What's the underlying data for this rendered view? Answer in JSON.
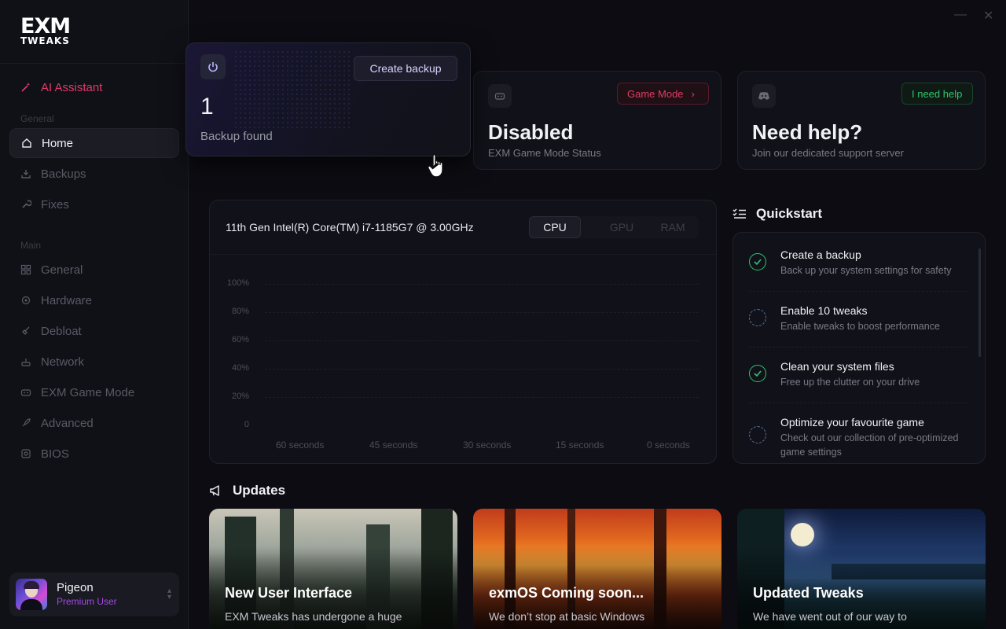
{
  "app": {
    "logo_line1": "EXM",
    "logo_line2": "TWEAKS"
  },
  "sidebar": {
    "ai_label": "AI Assistant",
    "section_general": "General",
    "section_main": "Main",
    "items_general": [
      {
        "label": "Home",
        "icon": "home-icon"
      },
      {
        "label": "Backups",
        "icon": "backup-icon"
      },
      {
        "label": "Fixes",
        "icon": "wrench-icon"
      }
    ],
    "items_main": [
      {
        "label": "General",
        "icon": "grid-icon"
      },
      {
        "label": "Hardware",
        "icon": "chip-icon"
      },
      {
        "label": "Debloat",
        "icon": "broom-icon"
      },
      {
        "label": "Network",
        "icon": "network-icon"
      },
      {
        "label": "EXM Game Mode",
        "icon": "gamepad-icon"
      },
      {
        "label": "Advanced",
        "icon": "rocket-icon"
      },
      {
        "label": "BIOS",
        "icon": "bios-icon"
      }
    ]
  },
  "user": {
    "name": "Pigeon",
    "role": "Premium User"
  },
  "cards": {
    "backup": {
      "button": "Create backup",
      "count": "1",
      "label": "Backup found"
    },
    "gamemode": {
      "button": "Game Mode",
      "status": "Disabled",
      "label": "EXM Game Mode Status"
    },
    "help": {
      "button": "I need help",
      "title": "Need help?",
      "label": "Join our dedicated support server"
    }
  },
  "monitor": {
    "cpu_name": "11th Gen Intel(R) Core(TM) i7-1185G7 @ 3.00GHz",
    "tabs": [
      "CPU",
      "GPU",
      "RAM"
    ],
    "active_tab": "CPU"
  },
  "chart_data": {
    "type": "line",
    "title": "",
    "yticks": [
      "100%",
      "80%",
      "60%",
      "40%",
      "20%",
      "0"
    ],
    "xticks": [
      "60 seconds",
      "45 seconds",
      "30 seconds",
      "15 seconds",
      "0 seconds"
    ],
    "ylim": [
      0,
      100
    ],
    "grid": true,
    "series": []
  },
  "quickstart": {
    "title": "Quickstart",
    "items": [
      {
        "title": "Create a backup",
        "desc": "Back up your system settings for safety",
        "done": true
      },
      {
        "title": "Enable 10 tweaks",
        "desc": "Enable tweaks to boost performance",
        "done": false
      },
      {
        "title": "Clean your system files",
        "desc": "Free up the clutter on your drive",
        "done": true
      },
      {
        "title": "Optimize your favourite game",
        "desc": "Check out our collection of pre-optimized game settings",
        "done": false
      }
    ]
  },
  "updates": {
    "title": "Updates",
    "items": [
      {
        "title": "New User Interface",
        "desc": "EXM Tweaks has undergone a huge"
      },
      {
        "title": "exmOS Coming soon...",
        "desc": "We don’t stop at basic Windows"
      },
      {
        "title": "Updated Tweaks",
        "desc": "We have went out of our way to"
      }
    ]
  },
  "colors": {
    "accent_ai": "#e23a66",
    "premium": "#a349e8",
    "success": "#2fc56b",
    "gamemode": "#e23a66",
    "help": "#2fc56b"
  }
}
